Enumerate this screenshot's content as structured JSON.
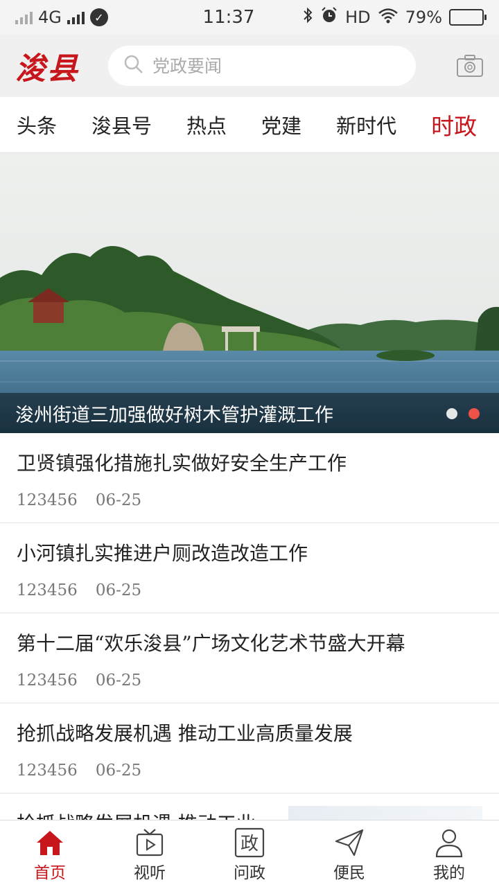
{
  "status_bar": {
    "network": "4G",
    "time": "11:37",
    "hd": "HD",
    "battery": "79%",
    "battery_level": 0.79
  },
  "header": {
    "logo": "浚县",
    "search_placeholder": "党政要闻",
    "icons": [
      "search-icon",
      "camera-icon"
    ]
  },
  "tabs": [
    {
      "label": "头条",
      "active": false
    },
    {
      "label": "浚县号",
      "active": false
    },
    {
      "label": "热点",
      "active": false
    },
    {
      "label": "党建",
      "active": false
    },
    {
      "label": "新时代",
      "active": false
    },
    {
      "label": "时政",
      "active": true
    }
  ],
  "banner": {
    "caption": "浚州街道三加强做好树木管护灌溉工作",
    "slide_count": 2,
    "active_slide": 2
  },
  "news": [
    {
      "title": "卫贤镇强化措施扎实做好安全生产工作",
      "source": "123456",
      "date": "06-25"
    },
    {
      "title": "小河镇扎实推进户厕改造改造工作",
      "source": "123456",
      "date": "06-25"
    },
    {
      "title": "第十二届“欢乐浚县”广场文化艺术节盛大开幕",
      "source": "123456",
      "date": "06-25"
    },
    {
      "title": "抢抓战略发展机遇 推动工业高质量发展",
      "source": "123456",
      "date": "06-25"
    }
  ],
  "partial_item": {
    "title": "抢抓战略发展机遇 推动工业"
  },
  "bottom_nav": [
    {
      "label": "首页",
      "icon": "home-icon",
      "active": true
    },
    {
      "label": "视听",
      "icon": "tv-play-icon",
      "active": false
    },
    {
      "label": "问政",
      "icon": "zheng-seal-icon",
      "glyph": "政",
      "active": false
    },
    {
      "label": "便民",
      "icon": "paper-plane-icon",
      "active": false
    },
    {
      "label": "我的",
      "icon": "user-icon",
      "active": false
    }
  ],
  "colors": {
    "accent": "#c8161d",
    "dot_active": "#ef5348"
  }
}
